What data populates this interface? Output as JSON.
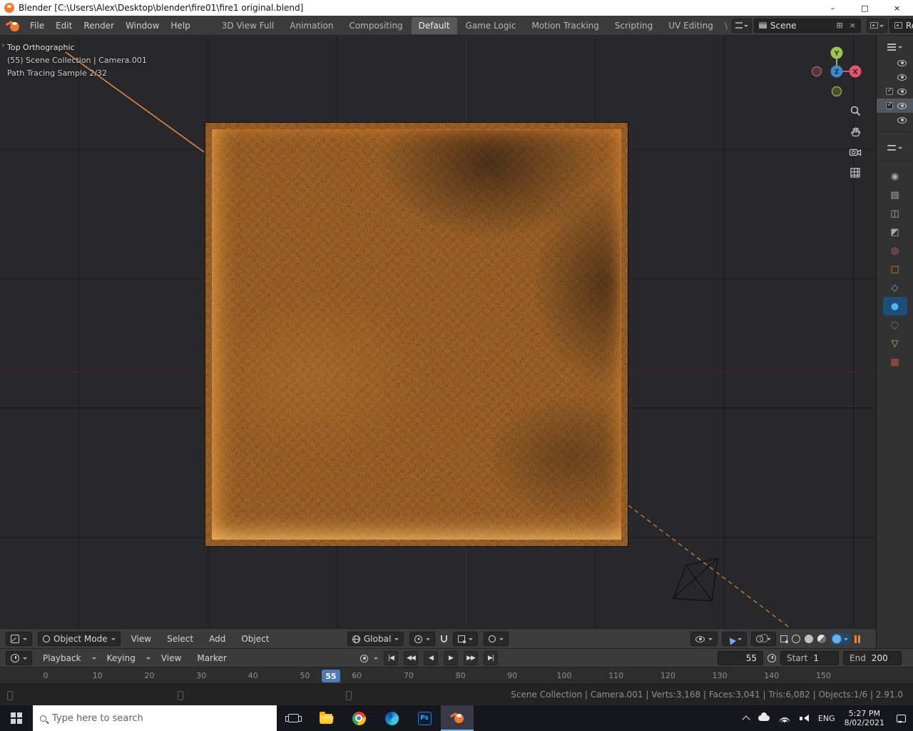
{
  "window": {
    "title": "Blender [C:\\Users\\Alex\\Desktop\\blender\\fire01\\fire1 original.blend]",
    "minimize": "–",
    "maximize": "□",
    "close": "×"
  },
  "topbar": {
    "menus": [
      "File",
      "Edit",
      "Render",
      "Window",
      "Help"
    ],
    "workspaces": [
      "3D View Full",
      "Animation",
      "Compositing",
      "Default",
      "Game Logic",
      "Motion Tracking",
      "Scripting",
      "UV Editing"
    ],
    "active_workspace": "Default",
    "separator": "\\",
    "scene": {
      "value": "Scene",
      "new": "⊞",
      "unlink": "×"
    },
    "layer": {
      "value": "RenderLayer",
      "new": "⊞",
      "unlink": "×"
    }
  },
  "viewport": {
    "expand_arrow": "›",
    "overlay": [
      "Top Orthographic",
      "(55) Scene Collection | Camera.001",
      "Path Tracing Sample 2/32"
    ],
    "axes": {
      "x": "X",
      "y": "Y",
      "z": "Z"
    },
    "header": {
      "mode": "Object Mode",
      "menus": [
        "View",
        "Select",
        "Add",
        "Object"
      ],
      "orientation": "Global"
    }
  },
  "timeline": {
    "menus": [
      "Playback",
      "Keying",
      "View",
      "Marker"
    ],
    "transport": [
      "|◀",
      "◀◀",
      "◀",
      "▶",
      "▶▶",
      "▶|"
    ],
    "current_frame": "55",
    "playhead": "55",
    "start_label": "Start",
    "start_value": "1",
    "end_label": "End",
    "end_value": "200",
    "ticks": [
      "0",
      "10",
      "20",
      "30",
      "40",
      "50",
      "60",
      "70",
      "80",
      "90",
      "100",
      "110",
      "120",
      "130",
      "140",
      "150"
    ]
  },
  "status": {
    "text": "Scene Collection | Camera.001 | Verts:3,168 | Faces:3,041 | Tris:6,082 | Objects:1/6 | 2.91.0"
  },
  "right_rail": {
    "tabs": [
      {
        "name": "render",
        "glyph": "◉"
      },
      {
        "name": "output",
        "glyph": "▤"
      },
      {
        "name": "view-layer",
        "glyph": "◫"
      },
      {
        "name": "scene",
        "glyph": "◩"
      },
      {
        "name": "world",
        "glyph": "◍"
      },
      {
        "name": "object",
        "glyph": "□"
      },
      {
        "name": "modifiers",
        "glyph": "◇"
      },
      {
        "name": "physics",
        "glyph": "●"
      },
      {
        "name": "particles",
        "glyph": "◌"
      },
      {
        "name": "object-data",
        "glyph": "▽"
      },
      {
        "name": "texture",
        "glyph": "▦"
      }
    ]
  },
  "taskbar": {
    "search_placeholder": "Type here to search",
    "photoshop": "Ps",
    "language": "ENG",
    "time": "5:27 PM",
    "date": "8/02/2021"
  },
  "colors": {
    "accent_blue": "#4f7bb8",
    "blender_orange": "#f5792a",
    "fire_core": "#ffd27a",
    "header_gray": "#3b3b3b"
  }
}
